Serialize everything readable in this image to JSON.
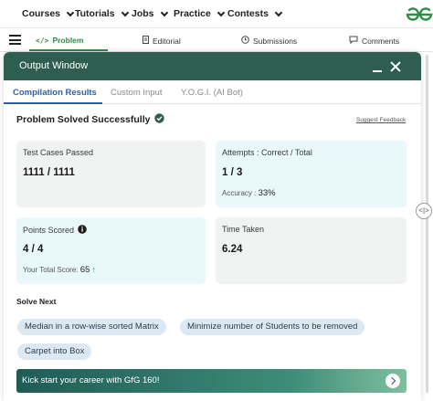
{
  "topnav": {
    "items": [
      {
        "label": "Courses"
      },
      {
        "label": "Tutorials"
      },
      {
        "label": "Jobs"
      },
      {
        "label": "Practice"
      },
      {
        "label": "Contests"
      }
    ],
    "logo_icon": "gfg-logo-icon",
    "brand_color": "#2f8d46"
  },
  "problem_tabs": [
    {
      "label": "Problem",
      "icon": "code-icon"
    },
    {
      "label": "Editorial",
      "icon": "document-icon"
    },
    {
      "label": "Submissions",
      "icon": "clock-icon"
    },
    {
      "label": "Comments",
      "icon": "chat-bubble-icon"
    }
  ],
  "output_window": {
    "title": "Output Window",
    "header_color": "#2d5e4f",
    "tabs": [
      {
        "label": "Compilation Results"
      },
      {
        "label": "Custom Input"
      },
      {
        "label": "Y.O.G.I. (AI Bot)"
      }
    ],
    "status": "Problem Solved Successfully",
    "suggest_feedback": "Suggest Feedback",
    "cards": {
      "test_cases": {
        "label": "Test Cases Passed",
        "value": "1111 / 1111"
      },
      "attempts": {
        "label": "Attempts : Correct / Total",
        "value": "1 / 3",
        "accuracy_label": "Accuracy :",
        "accuracy_value": "33%"
      },
      "points": {
        "label": "Points Scored",
        "value": "4 / 4",
        "total_label": "Your Total Score:",
        "total_value": "65"
      },
      "time": {
        "label": "Time Taken",
        "value": "6.24"
      }
    },
    "solve_next": {
      "title": "Solve Next",
      "items": [
        "Median in a row-wise sorted Matrix",
        "Minimize number of Students to be removed",
        "Carpet into Box"
      ]
    },
    "banner": {
      "text": "Kick start your career with GfG 160!"
    }
  }
}
